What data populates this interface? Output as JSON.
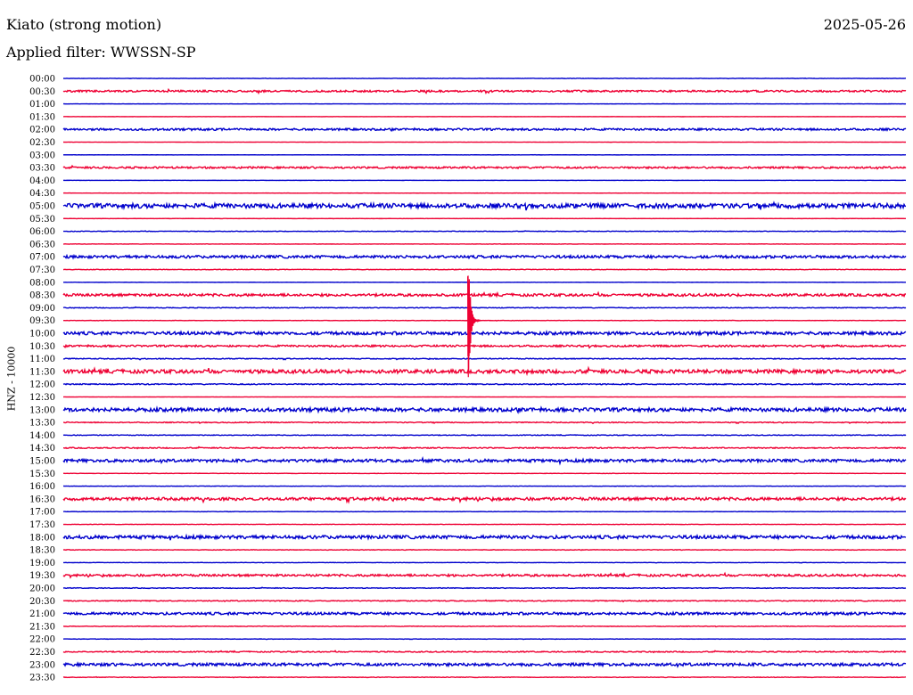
{
  "header": {
    "station": "Kiato (strong motion)",
    "date": "2025-05-26",
    "filter": "Applied filter: WWSSN-SP"
  },
  "channel_label": "HNZ - 10000",
  "colors": {
    "blue": "#0000cc",
    "red": "#ee0033",
    "text": "#000000",
    "background": "#ffffff"
  },
  "chart_data": {
    "type": "line",
    "title": "Kiato (strong motion)",
    "subtitle": "Applied filter: WWSSN-SP",
    "ylabel": "HNZ - 10000",
    "tick_labels": [
      "00:00",
      "00:30",
      "01:00",
      "01:30",
      "02:00",
      "02:30",
      "03:00",
      "03:30",
      "04:00",
      "04:30",
      "05:00",
      "05:30",
      "06:00",
      "06:30",
      "07:00",
      "07:30",
      "08:00",
      "08:30",
      "09:00",
      "09:30",
      "10:00",
      "10:30",
      "11:00",
      "11:30",
      "12:00",
      "12:30",
      "13:00",
      "13:30",
      "14:00",
      "14:30",
      "15:00",
      "15:30",
      "16:00",
      "16:30",
      "17:00",
      "17:30",
      "18:00",
      "18:30",
      "19:00",
      "19:30",
      "20:00",
      "20:30",
      "21:00",
      "21:30",
      "22:00",
      "22:30",
      "23:00",
      "23:30"
    ],
    "trace_colors": "alternating blue/red",
    "trace_noise_level": [
      0.2,
      1.0,
      0.1,
      0.1,
      1.1,
      0.1,
      0.1,
      1.0,
      0.1,
      0.1,
      2.5,
      0.1,
      0.3,
      0.2,
      1.5,
      0.3,
      0.1,
      1.4,
      0.4,
      0.2,
      1.7,
      1.0,
      0.5,
      2.0,
      0.6,
      0.1,
      2.0,
      0.5,
      0.4,
      0.6,
      1.6,
      0.2,
      0.2,
      1.6,
      0.2,
      0.2,
      1.8,
      0.3,
      0.2,
      1.2,
      0.4,
      0.5,
      1.4,
      0.3,
      0.2,
      0.6,
      1.6,
      0.3
    ],
    "event": {
      "trace": "09:30",
      "time_offset_min": 14.4,
      "peak_amplitude": 67,
      "note": "strong motion event near 09:44"
    }
  }
}
